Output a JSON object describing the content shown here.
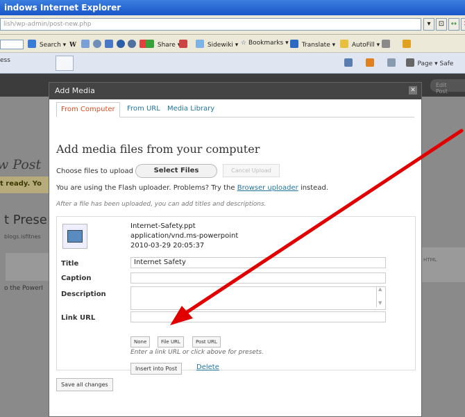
{
  "browser": {
    "title": "indows Internet Explorer",
    "address": "lish/wp-admin/post-new.php",
    "addr_buttons": [
      "▾",
      "⊡",
      "↔",
      "✕"
    ],
    "toolbar": [
      "Search ▾",
      "Share ▾",
      "Sidewiki ▾",
      "Bookmarks ▾",
      "Translate ▾",
      "AutoFill ▾"
    ],
    "tab_label": "ess",
    "tab_tools": "Page ▾  Safe"
  },
  "wp_background": {
    "edit_button": "Edit Post",
    "new_post": "w Post",
    "notice": "t ready. Yo",
    "preset": "t Prese",
    "blogs": "blogs.isfitnes",
    "powerpoint": "o the PowerI",
    "right_col": "HTML"
  },
  "modal": {
    "title": "Add Media",
    "close": "✕",
    "tabs": [
      {
        "label": "From Computer",
        "active": true
      },
      {
        "label": "From URL",
        "active": false
      },
      {
        "label": "Media Library",
        "active": false
      }
    ],
    "heading": "Add media files from your computer",
    "choose_label": "Choose files to upload",
    "select_files": "Select Files",
    "cancel_upload": "Cancel Upload",
    "flash_prefix": "You are using the Flash uploader. Problems? Try the",
    "flash_link": "Browser uploader",
    "flash_suffix": "instead.",
    "after_upload": "After a file has been uploaded, you can add titles and descriptions.",
    "file": {
      "name": "Internet-Safety.ppt",
      "mime": "application/vnd.ms-powerpoint",
      "date": "2010-03-29 20:05:37"
    },
    "fields": {
      "title_label": "Title",
      "title_value": "Internet Safety",
      "caption_label": "Caption",
      "caption_value": "",
      "description_label": "Description",
      "description_value": "",
      "link_label": "Link URL",
      "link_value": ""
    },
    "link_buttons": [
      "None",
      "File URL",
      "Post URL"
    ],
    "link_hint": "Enter a link URL or click above for presets.",
    "insert_button": "Insert into Post",
    "delete_link": "Delete",
    "save_all": "Save all changes"
  },
  "annotation": {
    "arrow_color": "#e00000"
  }
}
